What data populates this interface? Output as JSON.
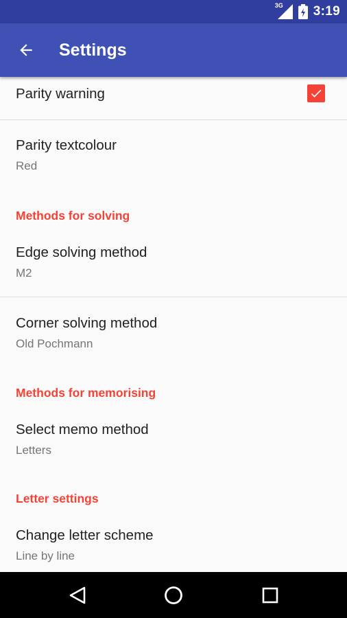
{
  "status_bar": {
    "network": "3G",
    "time": "3:19"
  },
  "app_bar": {
    "title": "Settings"
  },
  "preferences": {
    "parity_warning": {
      "title": "Parity warning",
      "checked": true
    },
    "parity_textcolour": {
      "title": "Parity textcolour",
      "summary": "Red"
    },
    "methods_solving_header": "Methods for solving",
    "edge_method": {
      "title": "Edge solving method",
      "summary": "M2"
    },
    "corner_method": {
      "title": "Corner solving method",
      "summary": "Old Pochmann"
    },
    "methods_memo_header": "Methods for memorising",
    "memo_method": {
      "title": "Select memo method",
      "summary": "Letters"
    },
    "letter_settings_header": "Letter settings",
    "letter_scheme": {
      "title": "Change letter scheme",
      "summary": "Line by line"
    }
  },
  "nav_bar": {
    "buttons": [
      "back-icon",
      "home-icon",
      "recents-icon"
    ]
  },
  "colors": {
    "status_bar": "#303f9f",
    "app_bar": "#3f51b5",
    "accent": "#f44336",
    "background": "#fafafa"
  }
}
